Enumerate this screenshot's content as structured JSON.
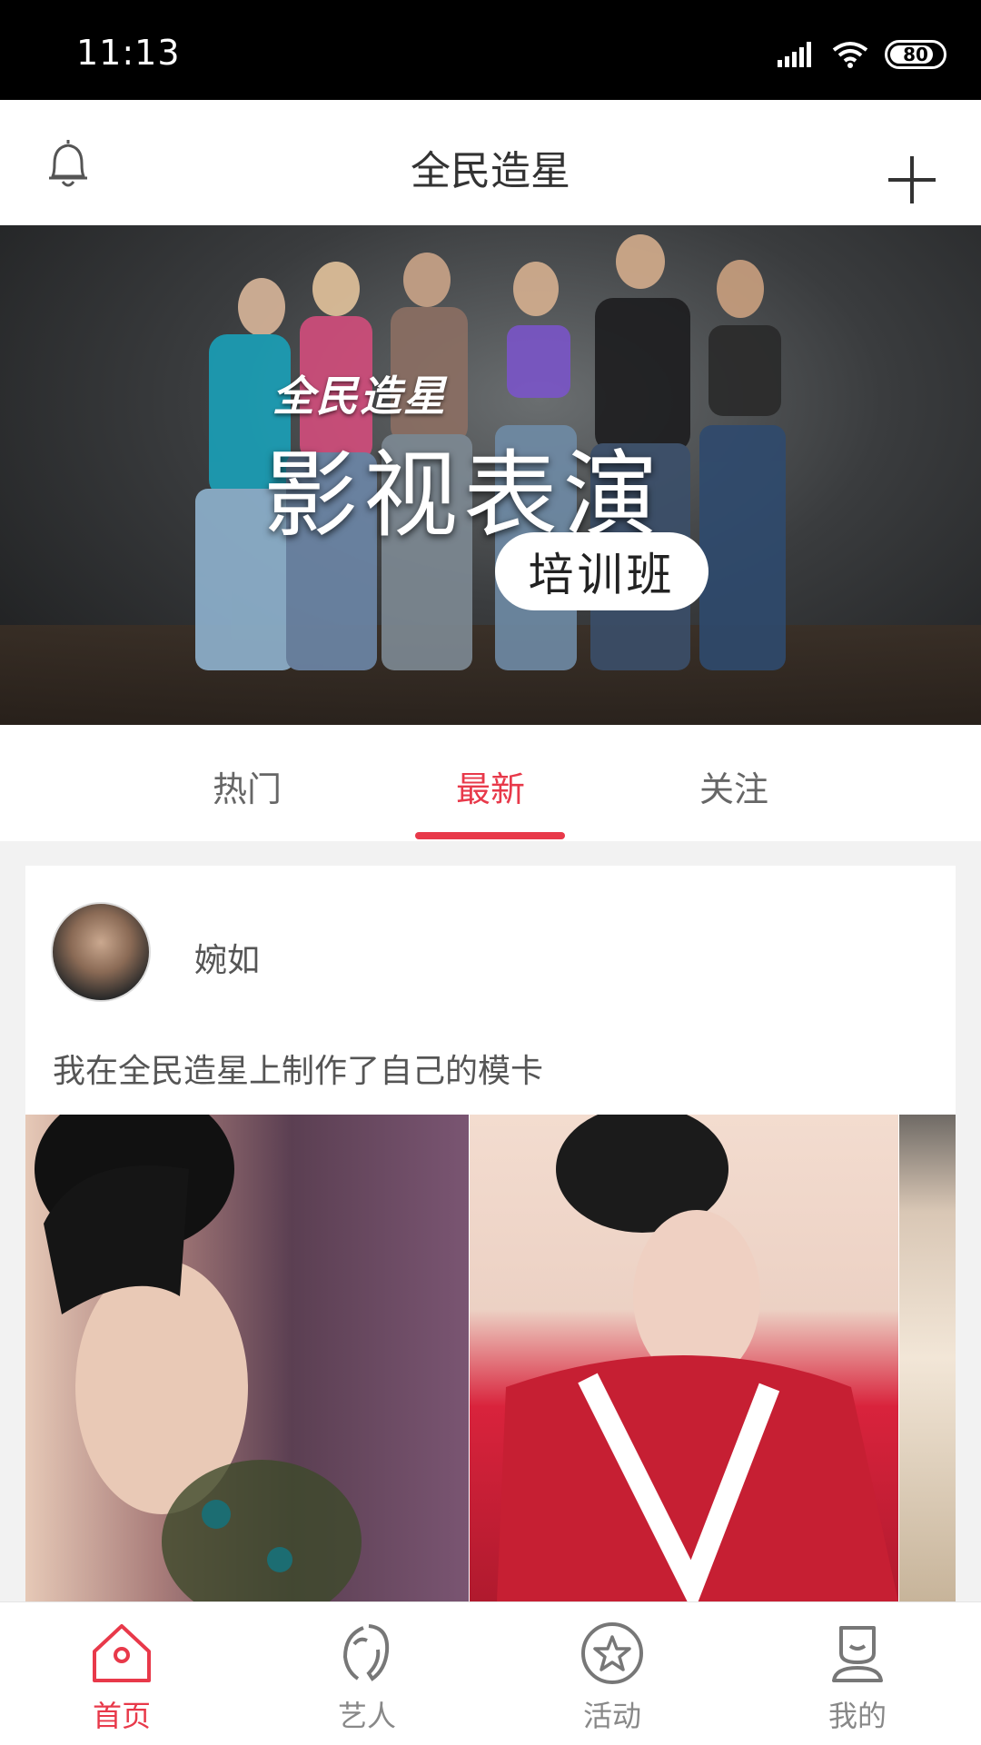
{
  "status_bar": {
    "time": "11:13",
    "battery": "80"
  },
  "header": {
    "title": "全民造星"
  },
  "banner": {
    "line1": "全民造星",
    "line2": "影视表演",
    "badge": "培训班",
    "dots": 4,
    "active_dot": 2
  },
  "tabs": [
    {
      "label": "热门"
    },
    {
      "label": "最新",
      "active": true
    },
    {
      "label": "关注"
    }
  ],
  "post": {
    "author": "婉如",
    "text": "我在全民造星上制作了自己的模卡"
  },
  "bottom_nav": [
    {
      "label": "首页",
      "icon": "home-icon",
      "active": true
    },
    {
      "label": "艺人",
      "icon": "artist-icon"
    },
    {
      "label": "活动",
      "icon": "star-icon"
    },
    {
      "label": "我的",
      "icon": "profile-icon"
    }
  ],
  "colors": {
    "accent": "#e8394a"
  }
}
